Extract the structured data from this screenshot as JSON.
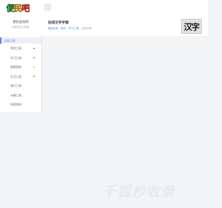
{
  "logo": {
    "chars": [
      "便",
      "民",
      "吧"
    ],
    "colors": [
      "#2e9e3c",
      "#f29a1a",
      "#e2453b"
    ]
  },
  "sidebar": {
    "title": "便民查询网",
    "subtitle": "免费在线工具箱",
    "section_header": "全部工具",
    "items": [
      {
        "label": "常用工具",
        "dot_color": "#e2453b"
      },
      {
        "label": "学习工具",
        "dot_color": "#4f7cf7"
      },
      {
        "label": "税收财经",
        "dot_color": "#f2b21a"
      },
      {
        "label": "生活工具",
        "dot_color": "#2e9e3c"
      },
      {
        "label": "娱乐工具",
        "dot_color": ""
      },
      {
        "label": "计算工具",
        "dot_color": ""
      },
      {
        "label": "快速查询",
        "dot_color": ""
      }
    ]
  },
  "page": {
    "title": "在线汉字字典",
    "breadcrumb": [
      "便民查询",
      "首页",
      "学习工具",
      "在线字典"
    ],
    "thumbnail_text": "汉字"
  },
  "watermark": "千狐秒收录"
}
